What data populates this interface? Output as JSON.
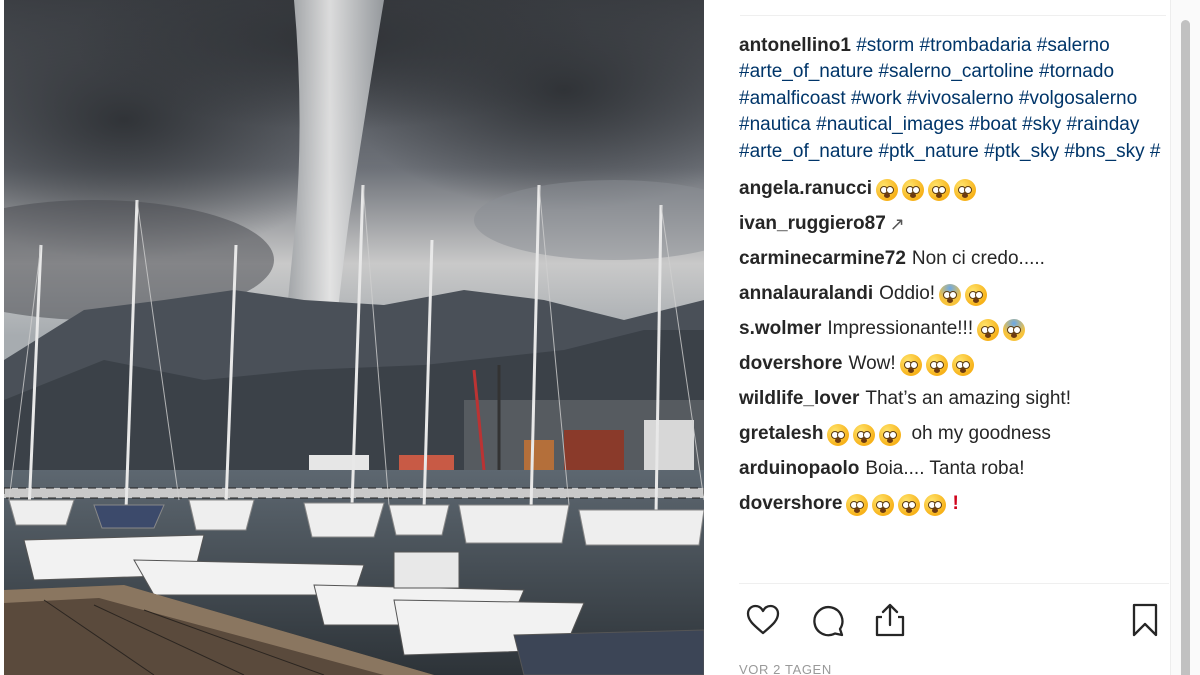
{
  "post": {
    "image_alt": "Waterspout over a marina with sailboats",
    "caption": {
      "username": "antonellino1",
      "hashtags": [
        "#storm",
        "#trombadaria",
        "#salerno",
        "#arte_of_nature",
        "#salerno_cartoline",
        "#tornado",
        "#amalficoast",
        "#work",
        "#vivosalerno",
        "#volgosalerno",
        "#nautica",
        "#nautical_images",
        "#boat",
        "#sky",
        "#rainday",
        "#arte_of_nature",
        "#ptk_nature",
        "#ptk_sky",
        "#bns_sky",
        "#"
      ]
    },
    "comments": [
      {
        "username": "angela.ranucci",
        "text": "",
        "emoji_after": 4,
        "emoji_type": "astonished"
      },
      {
        "username": "ivan_ruggiero87",
        "text": "",
        "emoji_after": 0,
        "extra": "telescope"
      },
      {
        "username": "carminecarmine72",
        "text": "Non ci credo.....",
        "emoji_after": 0
      },
      {
        "username": "annalauralandi",
        "text": "Oddio!",
        "emoji_after": 2,
        "emoji_type": "mixed-scream"
      },
      {
        "username": "s.wolmer",
        "text": "Impressionante!!!",
        "emoji_after": 2,
        "emoji_type": "mixed-fear"
      },
      {
        "username": "dovershore",
        "text": "Wow!",
        "emoji_after": 3,
        "emoji_type": "hushed"
      },
      {
        "username": "wildlife_lover",
        "text": "That’s an amazing sight!",
        "emoji_after": 0
      },
      {
        "username": "gretalesh",
        "text": "",
        "emoji_after": 3,
        "emoji_type": "hushed",
        "text_after": "oh my goodness"
      },
      {
        "username": "arduinopaolo",
        "text": "Boia.... Tanta roba!",
        "emoji_after": 0
      },
      {
        "username": "dovershore",
        "text": "",
        "emoji_after": 4,
        "emoji_type": "hushed",
        "extra": "exclamation"
      }
    ],
    "timestamp": "VOR 2 TAGEN",
    "icons": {
      "like": "heart-icon",
      "comment": "comment-icon",
      "share": "share-icon",
      "save": "bookmark-icon"
    }
  }
}
